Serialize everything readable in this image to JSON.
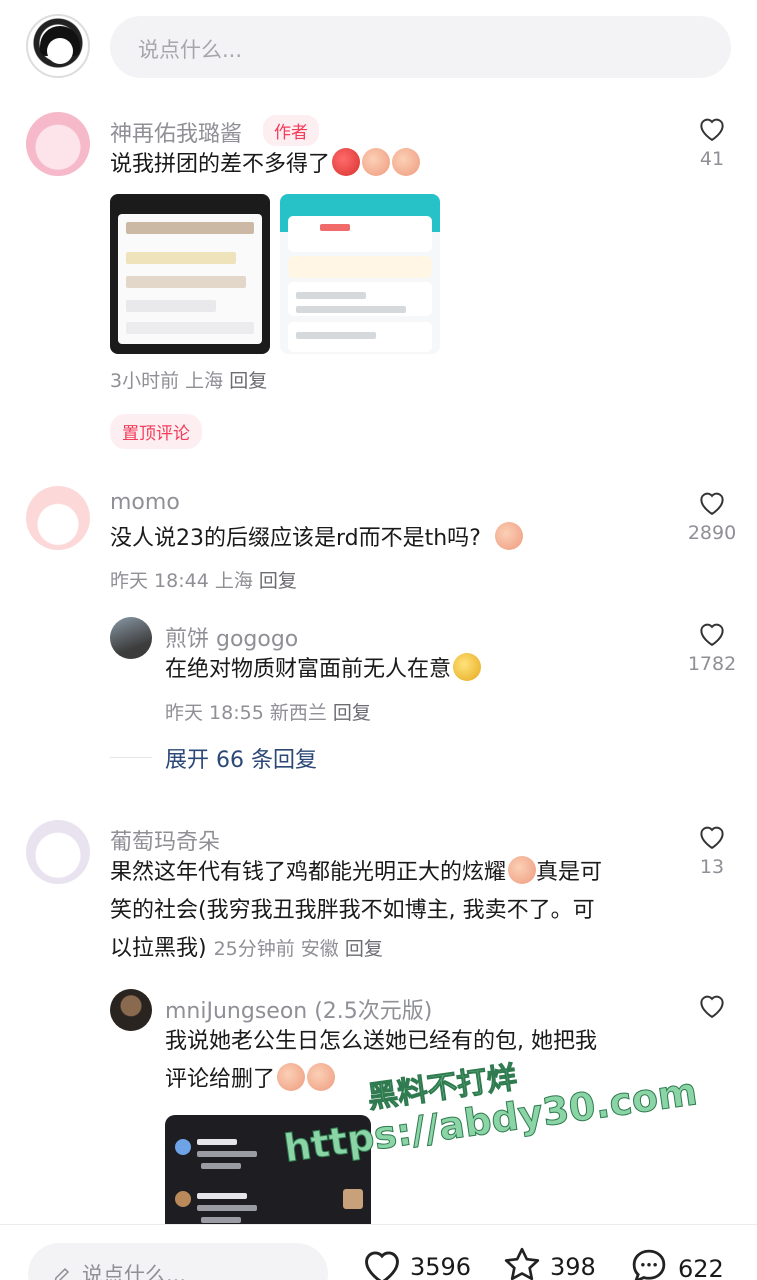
{
  "top": {
    "input_placeholder": "说点什么..."
  },
  "comments": [
    {
      "name": "神再佑我璐酱",
      "tag": "作者",
      "text": "说我拼团的差不多得了",
      "meta": "3小时前 上海",
      "reply": "回复",
      "likes": "41",
      "pinned": "置顶评论"
    },
    {
      "name": "momo",
      "text": "没人说23的后缀应该是rd而不是th吗?",
      "meta": "昨天 18:44 上海",
      "reply": "回复",
      "likes": "2890"
    },
    {
      "name": "煎饼 gogogo",
      "text": "在绝对物质财富面前无人在意",
      "meta": "昨天 18:55 新西兰",
      "reply": "回复",
      "likes": "1782"
    },
    {
      "name": "葡萄玛奇朵",
      "text_line1": "果然这年代有钱了鸡都能光明正大的炫耀",
      "text_line1b": "真是可",
      "text_line2": "笑的社会(我穷我丑我胖我不如博主, 我卖不了。可",
      "text_line3": "以拉黑我)",
      "meta": "25分钟前 安徽",
      "reply": "回复",
      "likes": "13"
    },
    {
      "name": "mniJungseon (2.5次元版)",
      "text_line1": "我说她老公生日怎么送她已经有的包, 她把我",
      "text_line2": "评论给删了",
      "likes": ""
    }
  ],
  "expand_replies": "展开 66 条回复",
  "watermark": {
    "line1": "黑料不打烊",
    "line2": "https://abdy30.com"
  },
  "bottom": {
    "input_placeholder": "说点什么...",
    "likes": "3596",
    "stars": "398",
    "comments": "622"
  },
  "icons": {
    "like": "heart-icon",
    "star": "star-icon",
    "comment": "comment-bubble-icon",
    "edit": "pencil-icon"
  }
}
